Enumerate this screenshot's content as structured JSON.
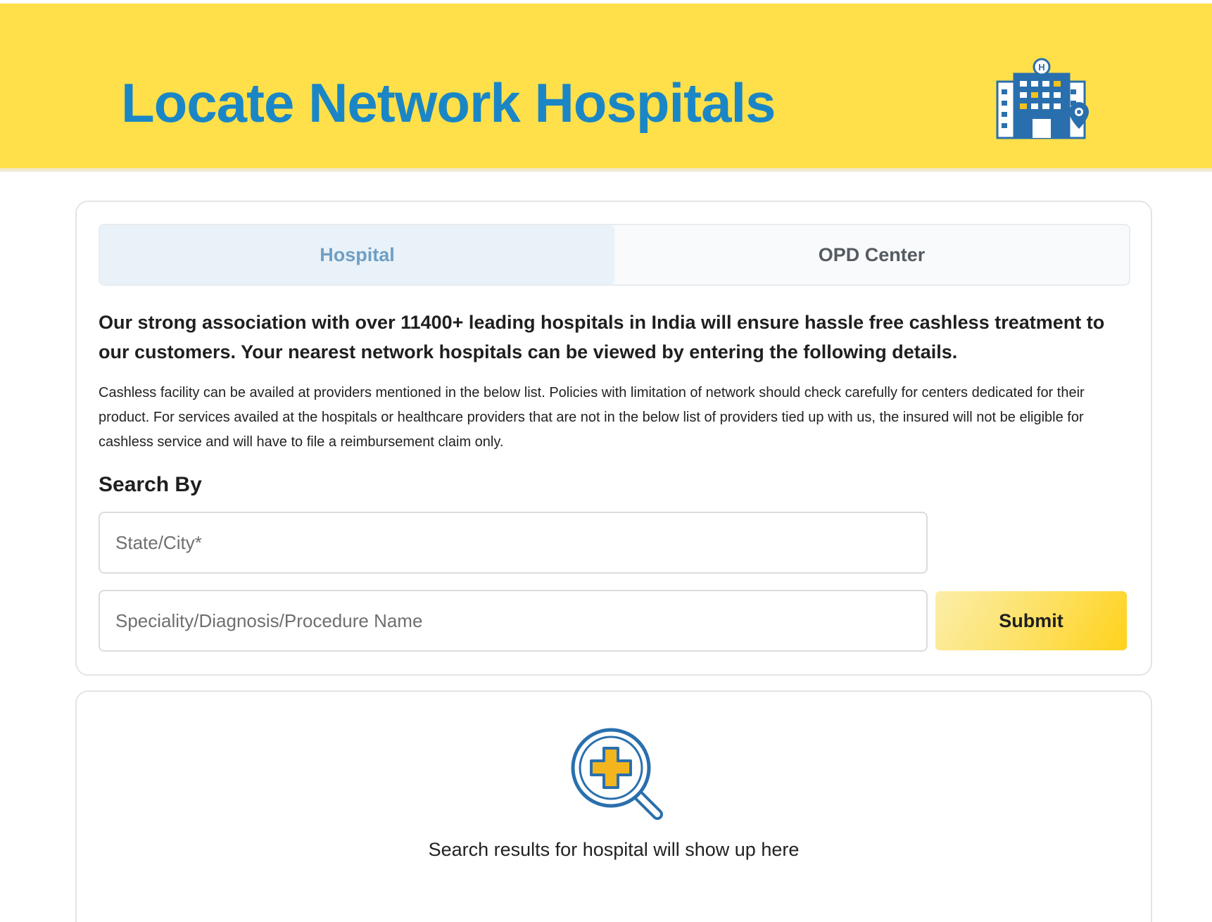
{
  "banner": {
    "title": "Locate Network Hospitals",
    "icon": "hospital-building-location-icon"
  },
  "tabs": [
    {
      "label": "Hospital",
      "active": true
    },
    {
      "label": "OPD Center",
      "active": false
    }
  ],
  "intro": {
    "lead": "Our strong association with over 11400+ leading hospitals in India will ensure hassle free cashless treatment to our customers. Your nearest network hospitals can be viewed by entering the following details.",
    "note": "Cashless facility can be availed at providers mentioned in the below list. Policies with limitation of network should check carefully for centers dedicated for their product. For services availed at the hospitals or healthcare providers that are not in the below list of providers tied up with us, the insured will not be eligible for cashless service and will have to file a reimbursement claim only."
  },
  "search": {
    "heading": "Search By",
    "location_placeholder": "State/City*",
    "speciality_placeholder": "Speciality/Diagnosis/Procedure Name",
    "submit_label": "Submit"
  },
  "results": {
    "icon": "medical-search-icon",
    "empty_text": "Search results for hospital will show up here"
  },
  "colors": {
    "banner_bg": "#ffe04a",
    "title": "#1b86c6",
    "active_tab_bg": "#e9f2f9",
    "active_tab_text": "#6f9fc3",
    "submit_gradient_end": "#ffd21a"
  }
}
